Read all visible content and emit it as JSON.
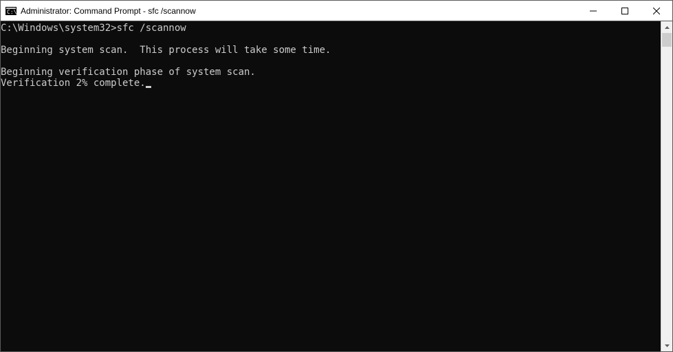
{
  "window": {
    "title": "Administrator: Command Prompt - sfc  /scannow"
  },
  "terminal": {
    "prompt": "C:\\Windows\\system32>",
    "command": "sfc /scannow",
    "lines": [
      "",
      "Beginning system scan.  This process will take some time.",
      "",
      "Beginning verification phase of system scan.",
      "Verification 2% complete."
    ]
  }
}
